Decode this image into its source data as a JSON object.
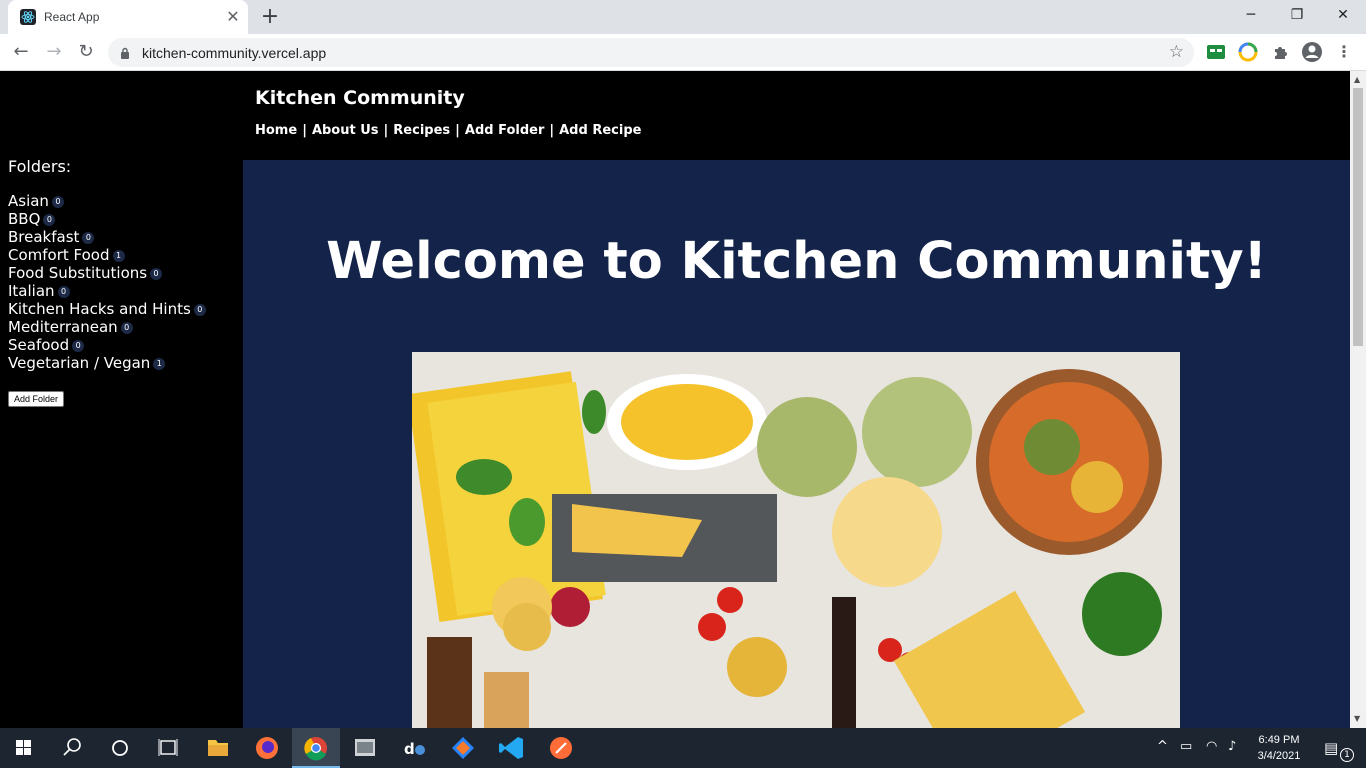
{
  "browser": {
    "tab_title": "React App",
    "url": "kitchen-community.vercel.app"
  },
  "site": {
    "title": "Kitchen Community",
    "nav": [
      "Home",
      "About Us",
      "Recipes",
      "Add Folder",
      "Add Recipe"
    ],
    "nav_separator": "|"
  },
  "sidebar": {
    "heading": "Folders:",
    "folders": [
      {
        "name": "Asian",
        "count": "0"
      },
      {
        "name": "BBQ",
        "count": "0"
      },
      {
        "name": "Breakfast",
        "count": "0"
      },
      {
        "name": "Comfort Food",
        "count": "1"
      },
      {
        "name": "Food Substitutions",
        "count": "0"
      },
      {
        "name": "Italian",
        "count": "0"
      },
      {
        "name": "Kitchen Hacks and Hints",
        "count": "0"
      },
      {
        "name": "Mediterranean",
        "count": "0"
      },
      {
        "name": "Seafood",
        "count": "0"
      },
      {
        "name": "Vegetarian / Vegan",
        "count": "1"
      }
    ],
    "add_folder_label": "Add Folder"
  },
  "main": {
    "welcome": "Welcome to Kitchen Community!"
  },
  "taskbar": {
    "time": "6:49 PM",
    "date": "3/4/2021",
    "notification_count": "1"
  },
  "colors": {
    "page_bg": "#000000",
    "main_bg": "#13234a",
    "badge_bg": "#1c2a48",
    "taskbar_bg": "#1c2530"
  }
}
